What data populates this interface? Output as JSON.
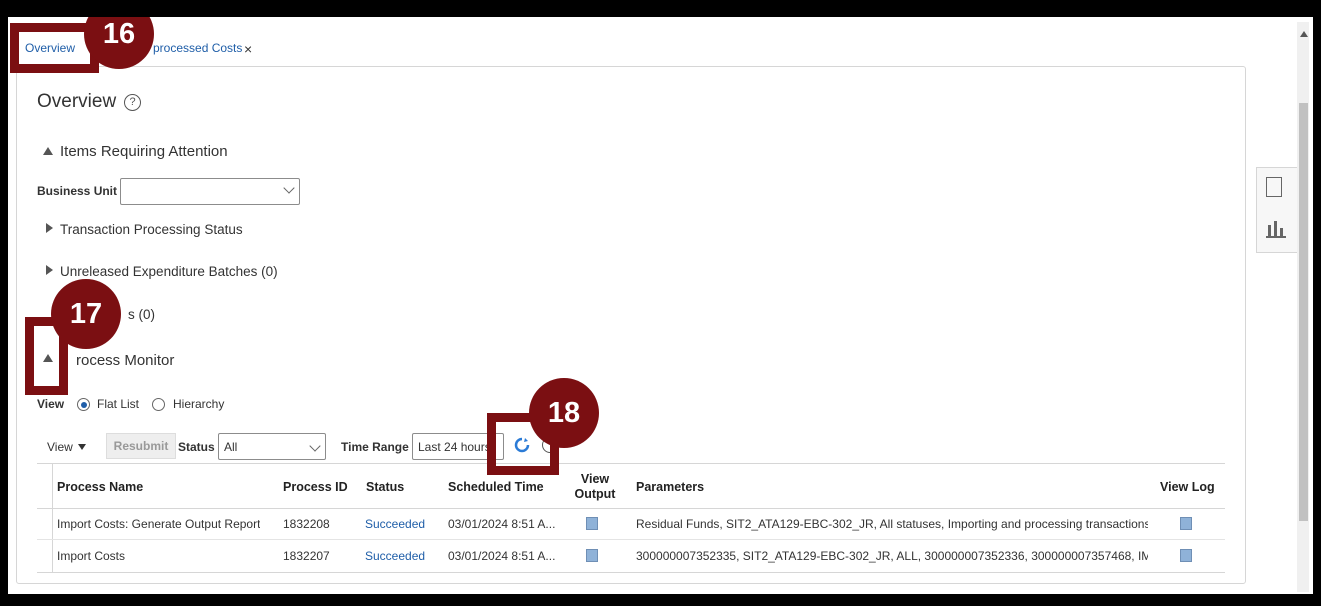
{
  "tabs": [
    {
      "label": "Overview"
    },
    {
      "label": "processed Costs"
    }
  ],
  "close_glyph": "×",
  "page": {
    "title": "Overview",
    "help_glyph": "?"
  },
  "attention": {
    "section_title": "Items Requiring Attention",
    "business_unit_label": "Business Unit",
    "business_unit_value": ""
  },
  "subsections": [
    {
      "label": "Transaction Processing Status"
    },
    {
      "label": "Unreleased Expenditure Batches (0)"
    },
    {
      "label": "s (0)"
    }
  ],
  "process_monitor": {
    "section_title": "rocess Monitor",
    "view_label": "View",
    "view_options": [
      {
        "label": "Flat List",
        "selected": true
      },
      {
        "label": "Hierarchy",
        "selected": false
      }
    ],
    "toolbar": {
      "view_menu": "View",
      "resubmit": "Resubmit",
      "status_label": "Status",
      "status_value": "All",
      "time_range_label": "Time Range",
      "time_range_value": "Last 24 hours"
    },
    "columns": [
      "Process Name",
      "Process ID",
      "Status",
      "Scheduled Time",
      "View Output",
      "Parameters",
      "View Log"
    ],
    "rows": [
      {
        "name": "Import Costs: Generate Output Report",
        "id": "1832208",
        "status": "Succeeded",
        "time": "03/01/2024 8:51 A...",
        "params": "Residual Funds, SIT2_ATA129-EBC-302_JR, All statuses, Importing and processing transactions, ..."
      },
      {
        "name": "Import Costs",
        "id": "1832207",
        "status": "Succeeded",
        "time": "03/01/2024 8:51 A...",
        "params": "300000007352335, SIT2_ATA129-EBC-302_JR, ALL, 300000007352336, 300000007357468, IM..."
      }
    ]
  },
  "callouts": [
    {
      "number": "16"
    },
    {
      "number": "17"
    },
    {
      "number": "18"
    }
  ],
  "colors": {
    "accent": "#1f5ea8",
    "callout": "#7b0f12"
  }
}
